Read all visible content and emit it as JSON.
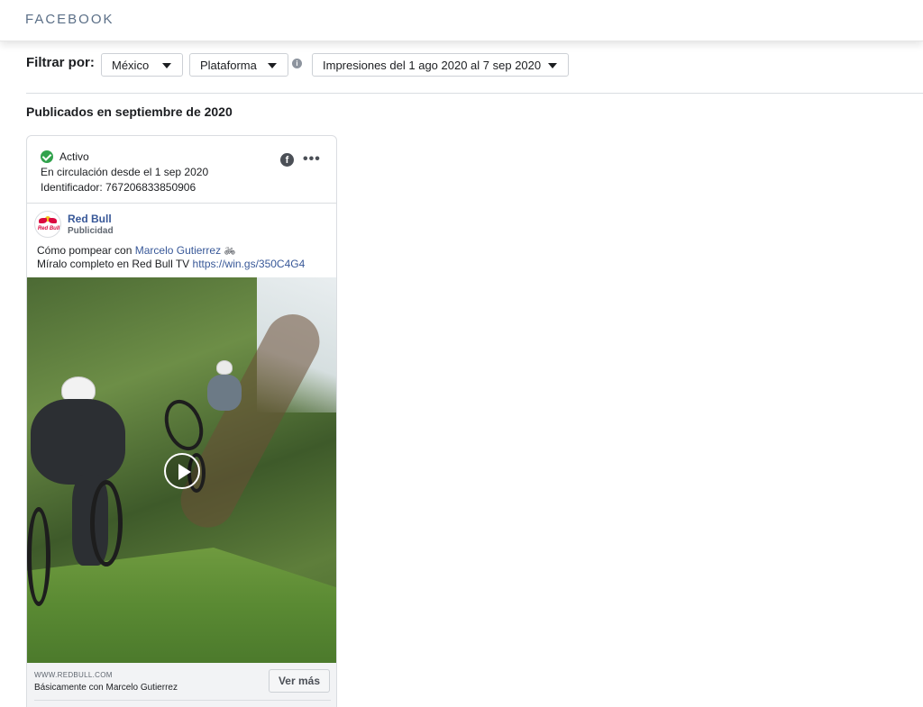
{
  "header": {
    "brand": "FACEBOOK"
  },
  "filters": {
    "label": "Filtrar por:",
    "country": {
      "selected": "México"
    },
    "platform": {
      "selected": "Plataforma"
    },
    "date_range": {
      "selected": "Impresiones del 1 ago 2020 al 7 sep 2020"
    }
  },
  "section": {
    "title": "Publicados en septiembre de 2020"
  },
  "ad": {
    "status": "Activo",
    "running_since": "En circulación desde el 1 sep 2020",
    "identifier": "Identificador: 767206833850906",
    "page_name": "Red Bull",
    "sponsored_label": "Publicidad",
    "avatar_text": "Red Bull",
    "text_line1_prefix": "Cómo pompear con ",
    "text_line1_mention": "Marcelo Gutierrez",
    "text_line2_prefix": "Míralo completo en Red Bull TV ",
    "text_line2_link": "https://win.gs/350C4G4",
    "cta": {
      "domain": "WWW.REDBULL.COM",
      "title": "Básicamente con Marcelo Gutierrez",
      "button_label": "Ver más"
    }
  },
  "icons": {
    "status": "check-circle-icon",
    "platform": "facebook-icon",
    "menu": "more-options-icon",
    "info": "info-icon",
    "video": "play-icon",
    "emoji": "bicycle-icon"
  },
  "colors": {
    "link": "#385898",
    "status_active": "#31a24c",
    "brand_text": "#5b6f87"
  }
}
